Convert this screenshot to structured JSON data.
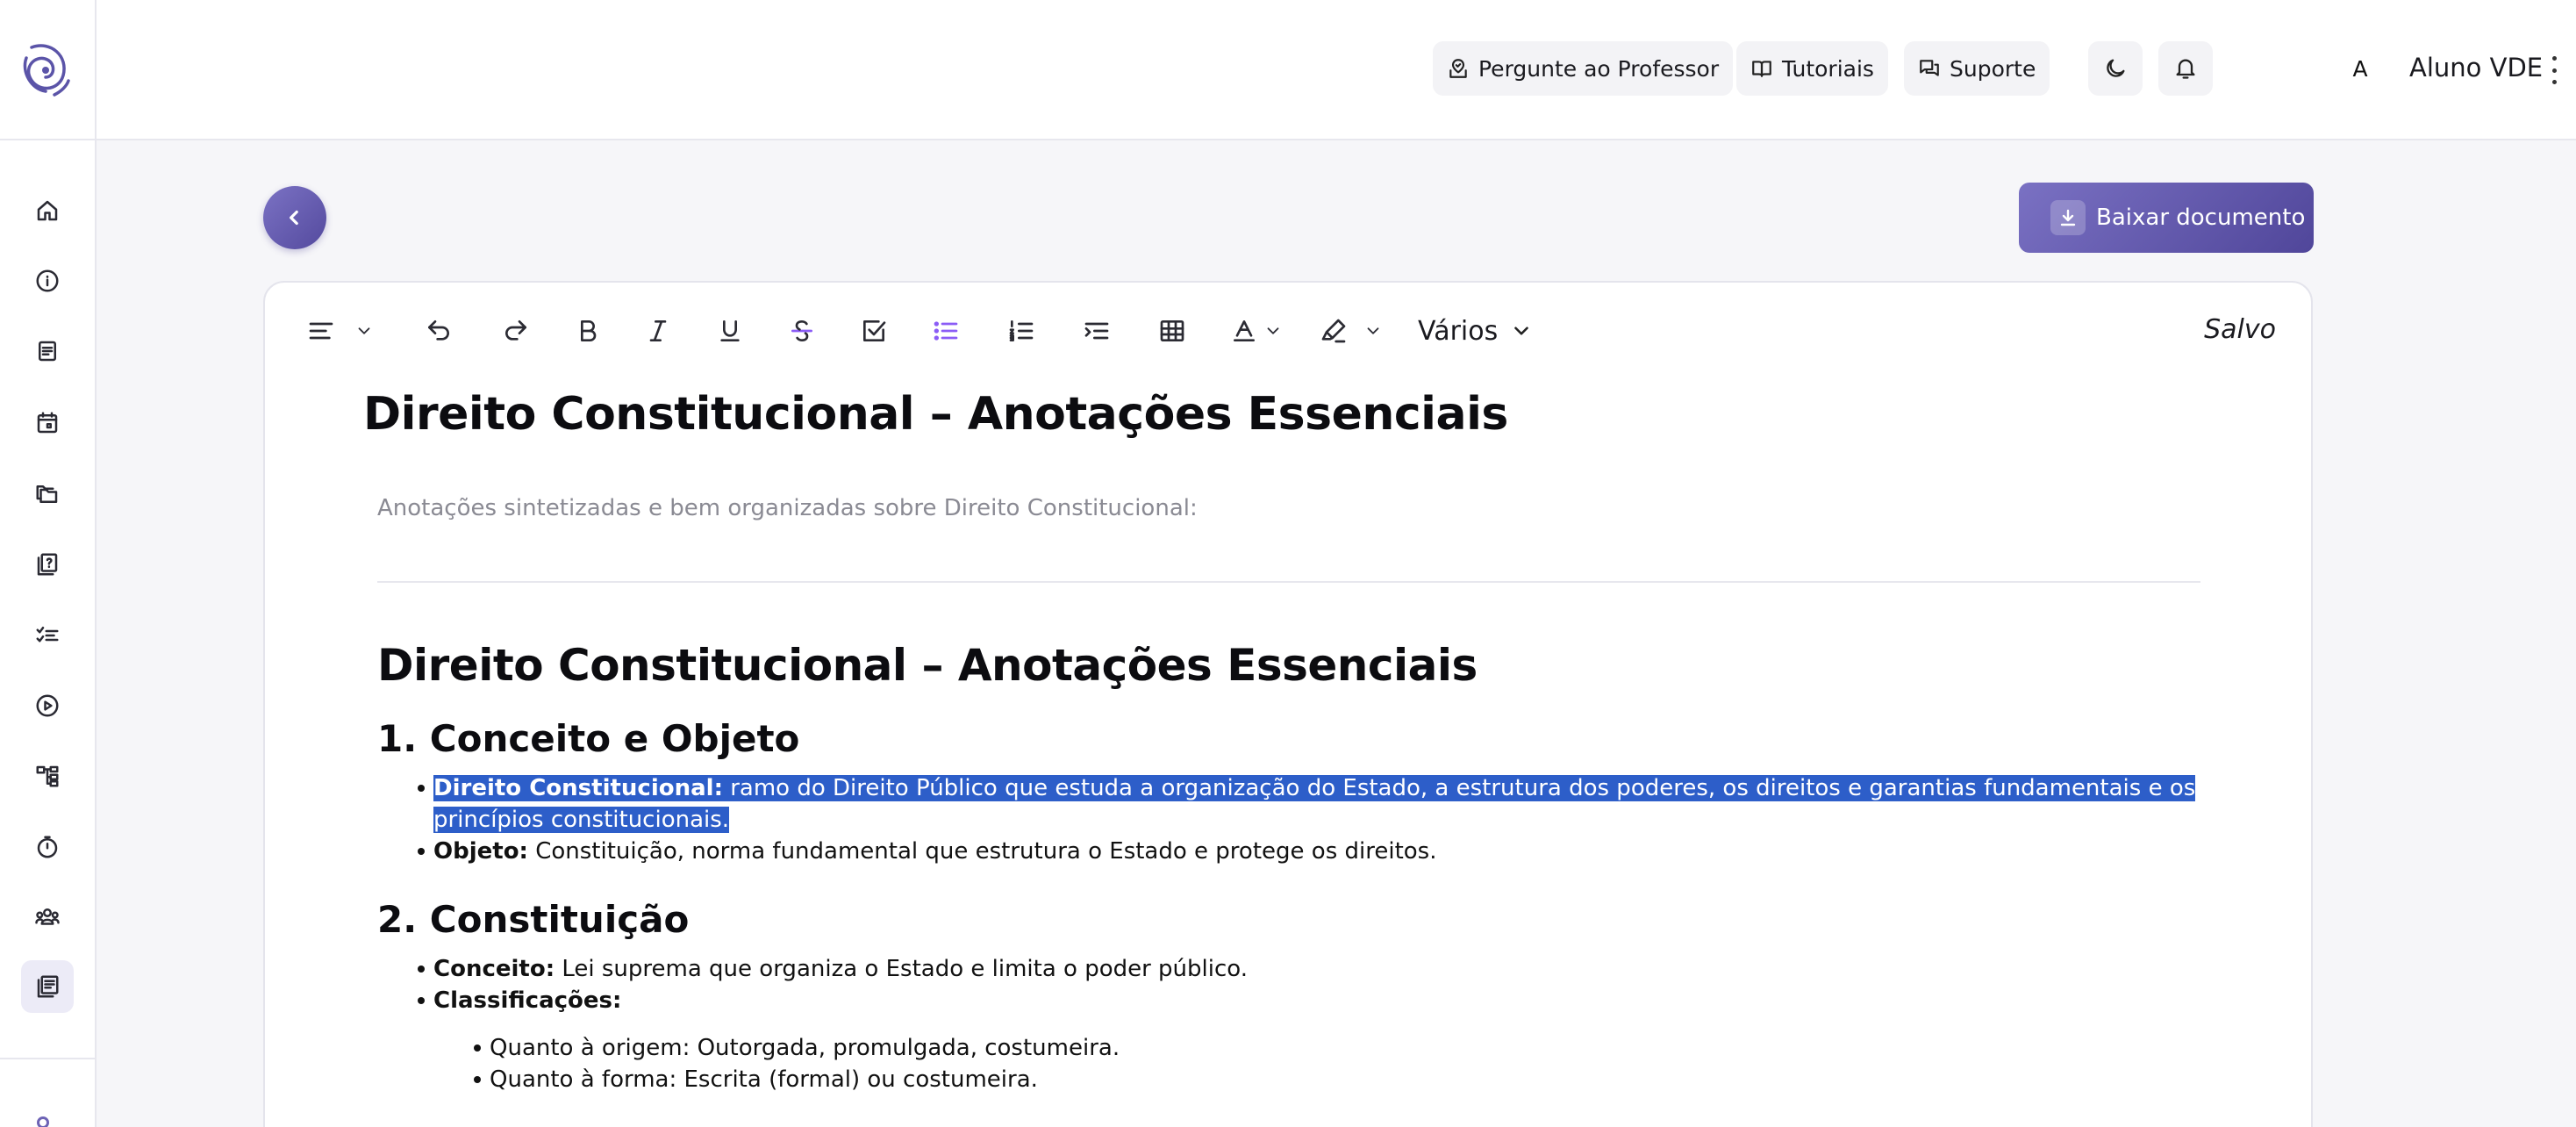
{
  "header": {
    "ask_professor": "Pergunte ao Professor",
    "tutorials": "Tutoriais",
    "support": "Suporte",
    "avatar_initial": "A",
    "username": "Aluno VDE"
  },
  "actions": {
    "download": "Baixar documento"
  },
  "toolbar": {
    "font_select": "Vários",
    "save_status": "Salvo"
  },
  "document": {
    "title": "Direito Constitucional – Anotações Essenciais",
    "subtitle": "Anotações sintetizadas e bem organizadas sobre Direito Constitucional:",
    "heading": "Direito Constitucional – Anotações Essenciais",
    "section1": {
      "title": "1. Conceito e Objeto",
      "item1_label": "Direito Constitucional:",
      "item1_text": " ramo do Direito Público que estuda a organização do Estado, a estrutura dos poderes, os direitos e garantias fundamentais e os princípios constitucionais.",
      "item2_label": "Objeto:",
      "item2_text": " Constituição, norma fundamental que estrutura o Estado e protege os direitos."
    },
    "section2": {
      "title": "2. Constituição",
      "item1_label": "Conceito:",
      "item1_text": " Lei suprema que organiza o Estado e limita o poder público.",
      "item2_label": "Classificações:",
      "sub1": "Quanto à origem: Outorgada, promulgada, costumeira.",
      "sub2": "Quanto à forma: Escrita (formal) ou costumeira."
    }
  }
}
